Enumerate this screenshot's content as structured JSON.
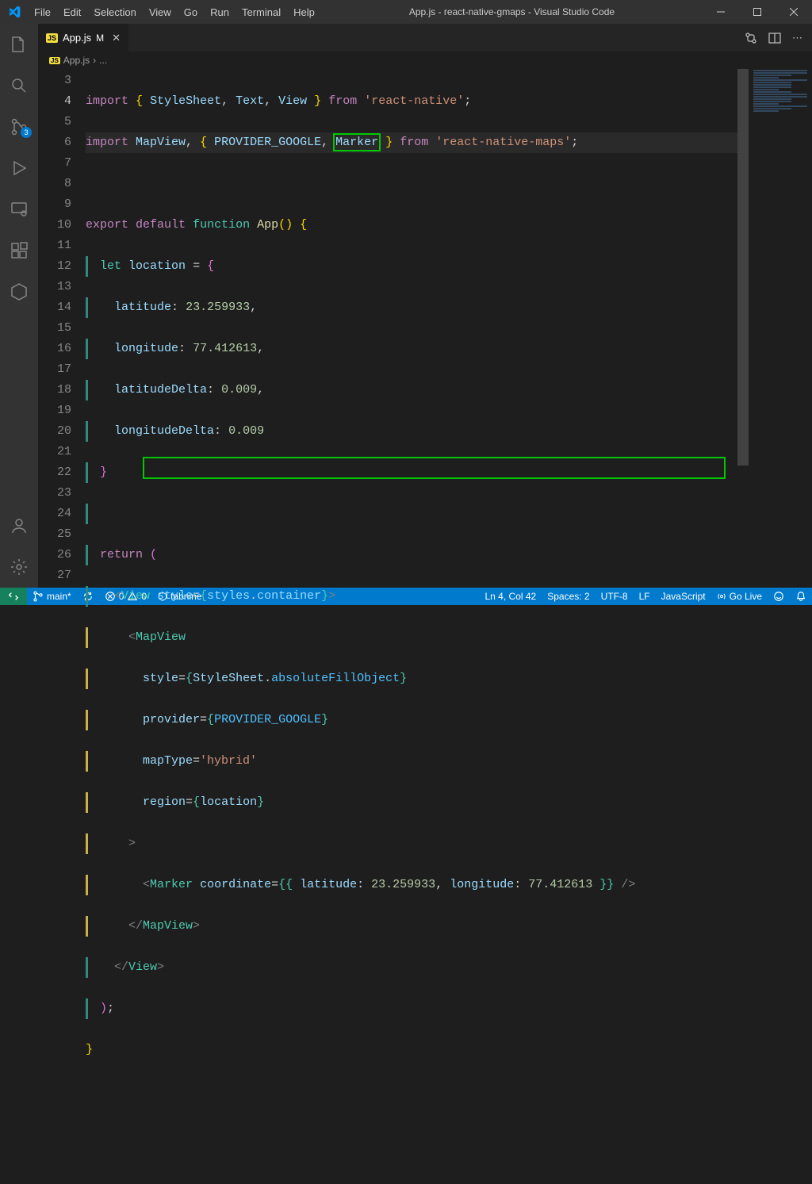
{
  "titlebar": {
    "menus": [
      "File",
      "Edit",
      "Selection",
      "View",
      "Go",
      "Run",
      "Terminal",
      "Help"
    ],
    "title": "App.js - react-native-gmaps - Visual Studio Code"
  },
  "activitybar": {
    "scm_badge": "3"
  },
  "tab": {
    "icon_label": "JS",
    "filename": "App.js",
    "modified": "M"
  },
  "breadcrumb": {
    "icon_label": "JS",
    "file": "App.js",
    "sep": "›",
    "rest": "..."
  },
  "line_numbers": [
    "3",
    "4",
    "5",
    "6",
    "7",
    "8",
    "9",
    "10",
    "11",
    "12",
    "13",
    "14",
    "15",
    "16",
    "17",
    "18",
    "19",
    "20",
    "21",
    "22",
    "23",
    "24",
    "25",
    "26",
    "27"
  ],
  "code": {
    "l3": {
      "import": "import",
      "b1": "{",
      "StyleSheet": "StyleSheet",
      "c1": ",",
      "Text": "Text",
      "c2": ",",
      "View": "View",
      "b2": "}",
      "from": "from",
      "str": "'react-native'",
      "semi": ";"
    },
    "l4": {
      "import": "import",
      "MapView": "MapView",
      "c1": ",",
      "b1": "{",
      "PROVIDER_GOOGLE": "PROVIDER_GOOGLE",
      "c2": ",",
      "Marker": "Marker",
      "b2": "}",
      "from": "from",
      "str": "'react-native-maps'",
      "semi": ";"
    },
    "l6": {
      "export": "export",
      "default": "default",
      "function": "function",
      "App": "App",
      "paren": "()",
      "brace": "{"
    },
    "l7": {
      "let": "let",
      "location": "location",
      "eq": "=",
      "brace": "{"
    },
    "l8": {
      "key": "latitude",
      "colon": ":",
      "val": "23.259933",
      "comma": ","
    },
    "l9": {
      "key": "longitude",
      "colon": ":",
      "val": "77.412613",
      "comma": ","
    },
    "l10": {
      "key": "latitudeDelta",
      "colon": ":",
      "val": "0.009",
      "comma": ","
    },
    "l11": {
      "key": "longitudeDelta",
      "colon": ":",
      "val": "0.009"
    },
    "l12": {
      "brace": "}"
    },
    "l14": {
      "return": "return",
      "paren": "("
    },
    "l15": {
      "open": "<",
      "tag": "View",
      "attr": "style",
      "eq": "=",
      "b1": "{",
      "obj": "styles",
      "dot": ".",
      "prop": "container",
      "b2": "}",
      "close": ">"
    },
    "l16": {
      "open": "<",
      "tag": "MapView"
    },
    "l17": {
      "attr": "style",
      "eq": "=",
      "b1": "{",
      "obj": "StyleSheet",
      "dot": ".",
      "prop": "absoluteFillObject",
      "b2": "}"
    },
    "l18": {
      "attr": "provider",
      "eq": "=",
      "b1": "{",
      "val": "PROVIDER_GOOGLE",
      "b2": "}"
    },
    "l19": {
      "attr": "mapType",
      "eq": "=",
      "val": "'hybrid'"
    },
    "l20": {
      "attr": "region",
      "eq": "=",
      "b1": "{",
      "val": "location",
      "b2": "}"
    },
    "l21": {
      "close": ">"
    },
    "l22": {
      "open": "<",
      "tag": "Marker",
      "attr": "coordinate",
      "eq": "=",
      "b1": "{{",
      "k1": "latitude",
      "c1": ":",
      "v1": "23.259933",
      "comma": ",",
      "k2": "longitude",
      "c2": ":",
      "v2": "77.412613",
      "b2": "}}",
      "close": "/>"
    },
    "l23": {
      "open": "</",
      "tag": "MapView",
      "close": ">"
    },
    "l24": {
      "open": "</",
      "tag": "View",
      "close": ">"
    },
    "l25": {
      "paren": ")",
      "semi": ";"
    },
    "l26": {
      "brace": "}"
    }
  },
  "statusbar": {
    "branch": "main*",
    "sync": "",
    "errors": "0",
    "warnings": "0",
    "tabnine": "tabnine",
    "position": "Ln 4, Col 42",
    "spaces": "Spaces: 2",
    "encoding": "UTF-8",
    "eol": "LF",
    "language": "JavaScript",
    "golive": "Go Live",
    "feedback": "",
    "bell": ""
  }
}
